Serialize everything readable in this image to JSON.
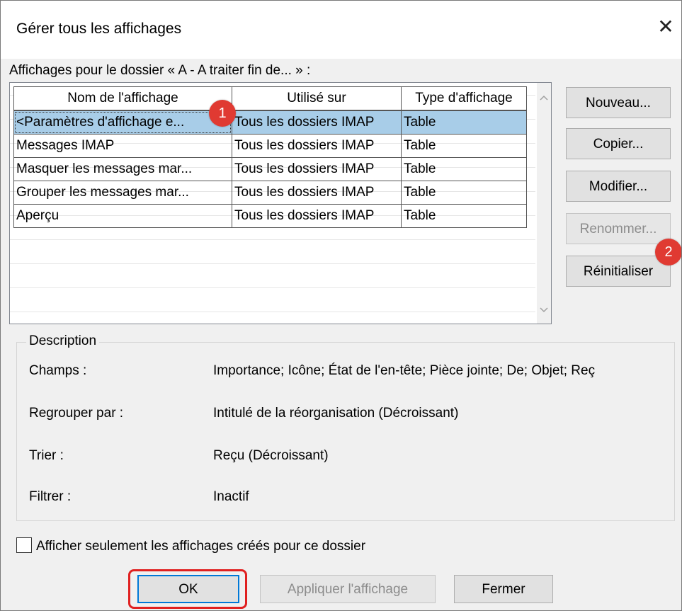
{
  "window": {
    "title": "Gérer tous les affichages",
    "close_glyph": "✕"
  },
  "list_label": "Affichages pour le dossier « A - A traiter fin de... » :",
  "table": {
    "columns": [
      "Nom de l'affichage",
      "Utilisé sur",
      "Type d'affichage"
    ],
    "rows": [
      [
        "<Paramètres d'affichage e...",
        "Tous les dossiers IMAP",
        "Table"
      ],
      [
        "Messages IMAP",
        "Tous les dossiers IMAP",
        "Table"
      ],
      [
        "Masquer les messages mar...",
        "Tous les dossiers IMAP",
        "Table"
      ],
      [
        "Grouper les messages mar...",
        "Tous les dossiers IMAP",
        "Table"
      ],
      [
        "Aperçu",
        "Tous les dossiers IMAP",
        "Table"
      ]
    ],
    "selected_row": 0
  },
  "scrollbar": {
    "up_icon": "chevron-up-icon",
    "down_icon": "chevron-down-icon"
  },
  "side_buttons": {
    "new": "Nouveau...",
    "copy": "Copier...",
    "modify": "Modifier...",
    "rename": "Renommer...",
    "reset": "Réinitialiser"
  },
  "description": {
    "legend": "Description",
    "fields_label": "Champs :",
    "fields_value": "Importance; Icône; État de l'en-tête; Pièce jointe; De; Objet; Reç",
    "group_label": "Regrouper par :",
    "group_value": "Intitulé de la réorganisation (Décroissant)",
    "sort_label": "Trier :",
    "sort_value": "Reçu (Décroissant)",
    "filter_label": "Filtrer :",
    "filter_value": "Inactif"
  },
  "checkbox": {
    "label": "Afficher seulement les affichages créés pour ce dossier",
    "checked": false
  },
  "footer_buttons": {
    "ok": "OK",
    "apply": "Appliquer l'affichage",
    "close": "Fermer"
  },
  "annotations": {
    "badge1": "1",
    "badge2": "2",
    "color": "#e03a32"
  }
}
